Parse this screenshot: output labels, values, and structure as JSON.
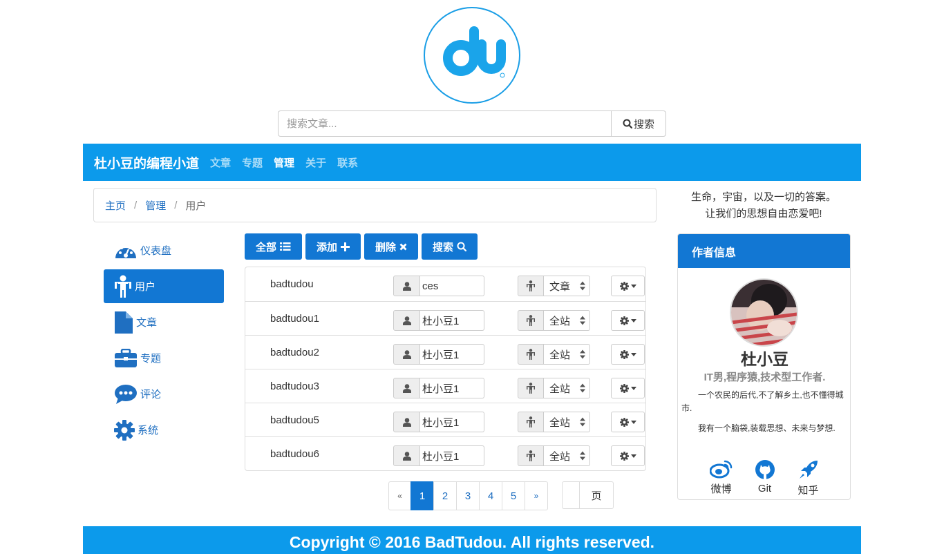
{
  "logo": {
    "text": "du"
  },
  "search": {
    "placeholder": "搜索文章...",
    "button_label": "搜索"
  },
  "navbar": {
    "brand": "杜小豆的编程小道",
    "links": [
      {
        "label": "文章",
        "active": false
      },
      {
        "label": "专题",
        "active": false
      },
      {
        "label": "管理",
        "active": true
      },
      {
        "label": "关于",
        "active": false
      },
      {
        "label": "联系",
        "active": false
      }
    ]
  },
  "breadcrumb": {
    "home": "主页",
    "admin": "管理",
    "current": "用户"
  },
  "sidebar": {
    "items": [
      {
        "label": "仪表盘",
        "icon": "dashboard-icon"
      },
      {
        "label": "用户",
        "icon": "user-icon",
        "active": true
      },
      {
        "label": "文章",
        "icon": "file-icon"
      },
      {
        "label": "专题",
        "icon": "briefcase-icon"
      },
      {
        "label": "评论",
        "icon": "comment-icon"
      },
      {
        "label": "系统",
        "icon": "gear-icon"
      }
    ]
  },
  "toolbar": {
    "all": "全部",
    "add": "添加",
    "delete": "删除",
    "search": "搜索"
  },
  "users": [
    {
      "username": "badtudou",
      "nickname": "ces",
      "scope": "文章"
    },
    {
      "username": "badtudou1",
      "nickname": "杜小豆1",
      "scope": "全站"
    },
    {
      "username": "badtudou2",
      "nickname": "杜小豆1",
      "scope": "全站"
    },
    {
      "username": "badtudou3",
      "nickname": "杜小豆1",
      "scope": "全站"
    },
    {
      "username": "badtudou5",
      "nickname": "杜小豆1",
      "scope": "全站"
    },
    {
      "username": "badtudou6",
      "nickname": "杜小豆1",
      "scope": "全站"
    }
  ],
  "pagination": {
    "prev": "«",
    "pages": [
      "1",
      "2",
      "3",
      "4",
      "5"
    ],
    "current": "1",
    "next": "»",
    "goto_suffix": "页"
  },
  "motto": {
    "line1": "生命，宇宙，以及一切的答案。",
    "line2": "让我们的思想自由恋爱吧!"
  },
  "author": {
    "panel_title": "作者信息",
    "name": "杜小豆",
    "subtitle": "IT男,程序猿,技术型工作者.",
    "desc1": "一个农民的后代,不了解乡土,也不懂得城市.",
    "desc2": "我有一个脑袋,装载思想、未来与梦想.",
    "social": [
      {
        "label": "微博",
        "icon": "weibo-icon"
      },
      {
        "label": "Git",
        "icon": "github-icon"
      },
      {
        "label": "知乎",
        "icon": "rocket-icon"
      }
    ]
  },
  "footer": {
    "text": "Copyright © 2016 BadTudou. All rights reserved."
  },
  "colors": {
    "primary": "#0c9aeb",
    "button": "#1277d3",
    "link": "#1f6fc1"
  }
}
